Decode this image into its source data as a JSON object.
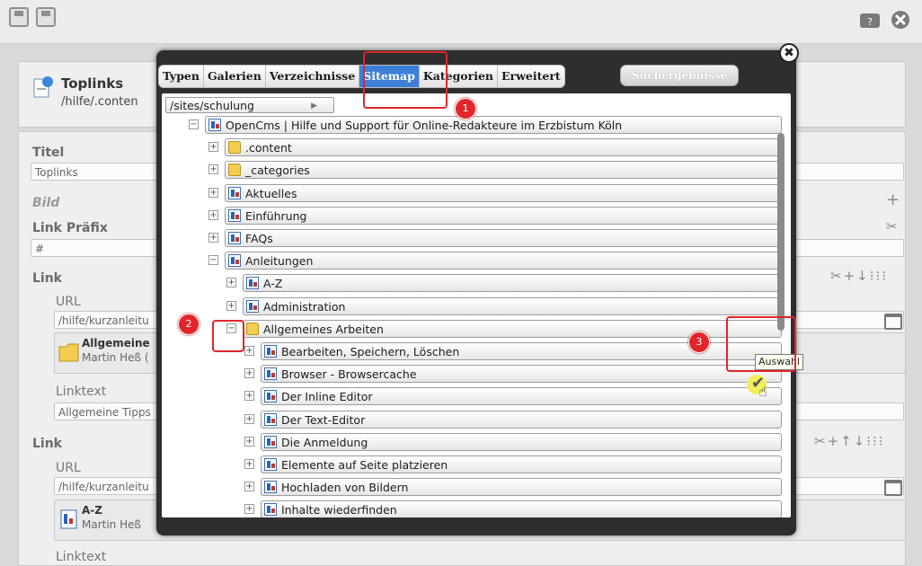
{
  "editor": {
    "resource_title": "Toplinks",
    "resource_path": "/hilfe/.conten",
    "fields": {
      "titel_label": "Titel",
      "titel_value": "Toplinks",
      "bild_label": "Bild",
      "link_praefix_label": "Link Präfix",
      "link_praefix_value": "#",
      "link1_label": "Link",
      "link1_url_label": "URL",
      "link1_url_value": "/hilfe/kurzanleitu",
      "link1_card_title": "Allgemeine",
      "link1_card_sub": "Martin Heß (",
      "link1_text_label": "Linktext",
      "link1_text_value": "Allgemeine Tipps",
      "link2_label": "Link",
      "link2_url_label": "URL",
      "link2_url_value": "/hilfe/kurzanleitu",
      "link2_card_title": "A-Z",
      "link2_card_sub": "Martin Heß",
      "link2_text_label": "Linktext"
    }
  },
  "dialog": {
    "tabs": [
      "Typen",
      "Galerien",
      "Verzeichnisse",
      "Sitemap",
      "Kategorien",
      "Erweitert"
    ],
    "active_tab": "Sitemap",
    "search_tab": "Suchergebnisse",
    "site_select": "/sites/schulung",
    "tree": [
      {
        "label": "OpenCms | Hilfe und Support für Online-Redakteure im Erzbistum Köln",
        "level": 0,
        "expander": "⊟",
        "icon": "page-icon"
      },
      {
        "label": ".content",
        "level": 1,
        "expander": "⊞",
        "icon": "content-folder-icon"
      },
      {
        "label": "_categories",
        "level": 1,
        "expander": "⊞",
        "icon": "folder-icon"
      },
      {
        "label": "Aktuelles",
        "level": 1,
        "expander": "⊞",
        "icon": "page-icon"
      },
      {
        "label": "Einführung",
        "level": 1,
        "expander": "⊞",
        "icon": "page-icon"
      },
      {
        "label": "FAQs",
        "level": 1,
        "expander": "⊞",
        "icon": "page-icon"
      },
      {
        "label": "Anleitungen",
        "level": 1,
        "expander": "⊟",
        "icon": "page-icon"
      },
      {
        "label": "A-Z",
        "level": 2,
        "expander": "⊞",
        "icon": "page-icon"
      },
      {
        "label": "Administration",
        "level": 2,
        "expander": "⊞",
        "icon": "page-icon"
      },
      {
        "label": "Allgemeines Arbeiten",
        "level": 2,
        "expander": "⊟",
        "icon": "folder-icon"
      },
      {
        "label": "Bearbeiten, Speichern, Löschen",
        "level": 3,
        "expander": "⊞",
        "icon": "page-icon"
      },
      {
        "label": "Browser - Browsercache",
        "level": 3,
        "expander": "⊞",
        "icon": "page-icon"
      },
      {
        "label": "Der Inline Editor",
        "level": 3,
        "expander": "⊞",
        "icon": "page-icon"
      },
      {
        "label": "Der Text-Editor",
        "level": 3,
        "expander": "⊞",
        "icon": "page-icon"
      },
      {
        "label": "Die Anmeldung",
        "level": 3,
        "expander": "⊞",
        "icon": "page-icon"
      },
      {
        "label": "Elemente auf Seite platzieren",
        "level": 3,
        "expander": "⊞",
        "icon": "page-icon"
      },
      {
        "label": "Hochladen von Bildern",
        "level": 3,
        "expander": "⊞",
        "icon": "page-icon"
      },
      {
        "label": "Inhalte wiederfinden",
        "level": 3,
        "expander": "⊞",
        "icon": "page-icon"
      }
    ],
    "select_tooltip": "Auswahl"
  },
  "annotations": {
    "badge1": "1",
    "badge2": "2",
    "badge3": "3",
    "color": "#e0262b"
  }
}
